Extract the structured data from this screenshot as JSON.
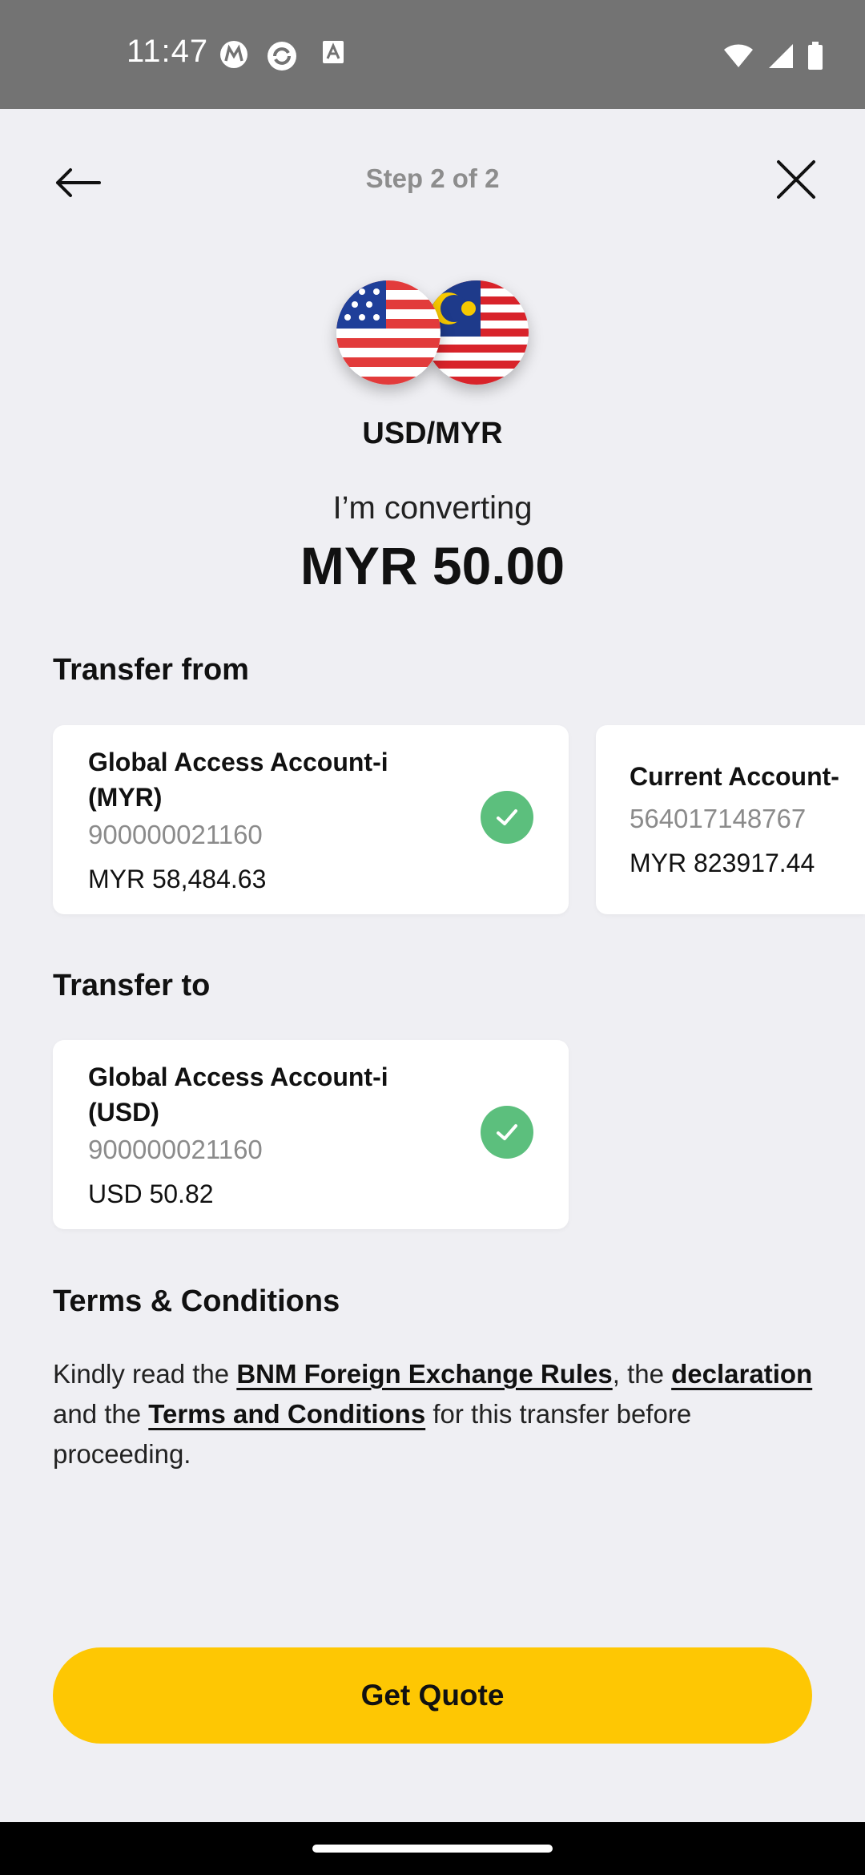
{
  "status_bar": {
    "time": "11:47",
    "left_icons": [
      "m-app-icon",
      "sync-icon",
      "font-icon"
    ],
    "right_icons": [
      "wifi-icon",
      "signal-icon",
      "battery-icon"
    ]
  },
  "header": {
    "step_label": "Step 2 of 2"
  },
  "currency": {
    "pair": "USD/MYR",
    "converting_label": "I’m converting",
    "amount": "MYR 50.00"
  },
  "transfer_from": {
    "title": "Transfer from",
    "accounts": [
      {
        "name": "Global Access Account-i (MYR)",
        "number": "900000021160",
        "balance": "MYR 58,484.63",
        "selected": true
      },
      {
        "name": "Current Account-",
        "number": "564017148767",
        "balance": "MYR 823917.44",
        "selected": false
      }
    ]
  },
  "transfer_to": {
    "title": "Transfer to",
    "account": {
      "name": "Global Access Account-i (USD)",
      "number": "900000021160",
      "balance": "USD 50.82",
      "selected": true
    }
  },
  "terms": {
    "title": "Terms & Conditions",
    "text_1": "Kindly read the ",
    "link_1": "BNM Foreign Exchange Rules",
    "text_2": ", the ",
    "link_2": "declaration",
    "text_3": " and the ",
    "link_3": "Terms and Conditions",
    "text_4": " for this transfer before proceeding."
  },
  "cta": {
    "label": "Get Quote"
  },
  "colors": {
    "accent": "#fec703",
    "success": "#5cbf7d",
    "background": "#efeff3"
  }
}
